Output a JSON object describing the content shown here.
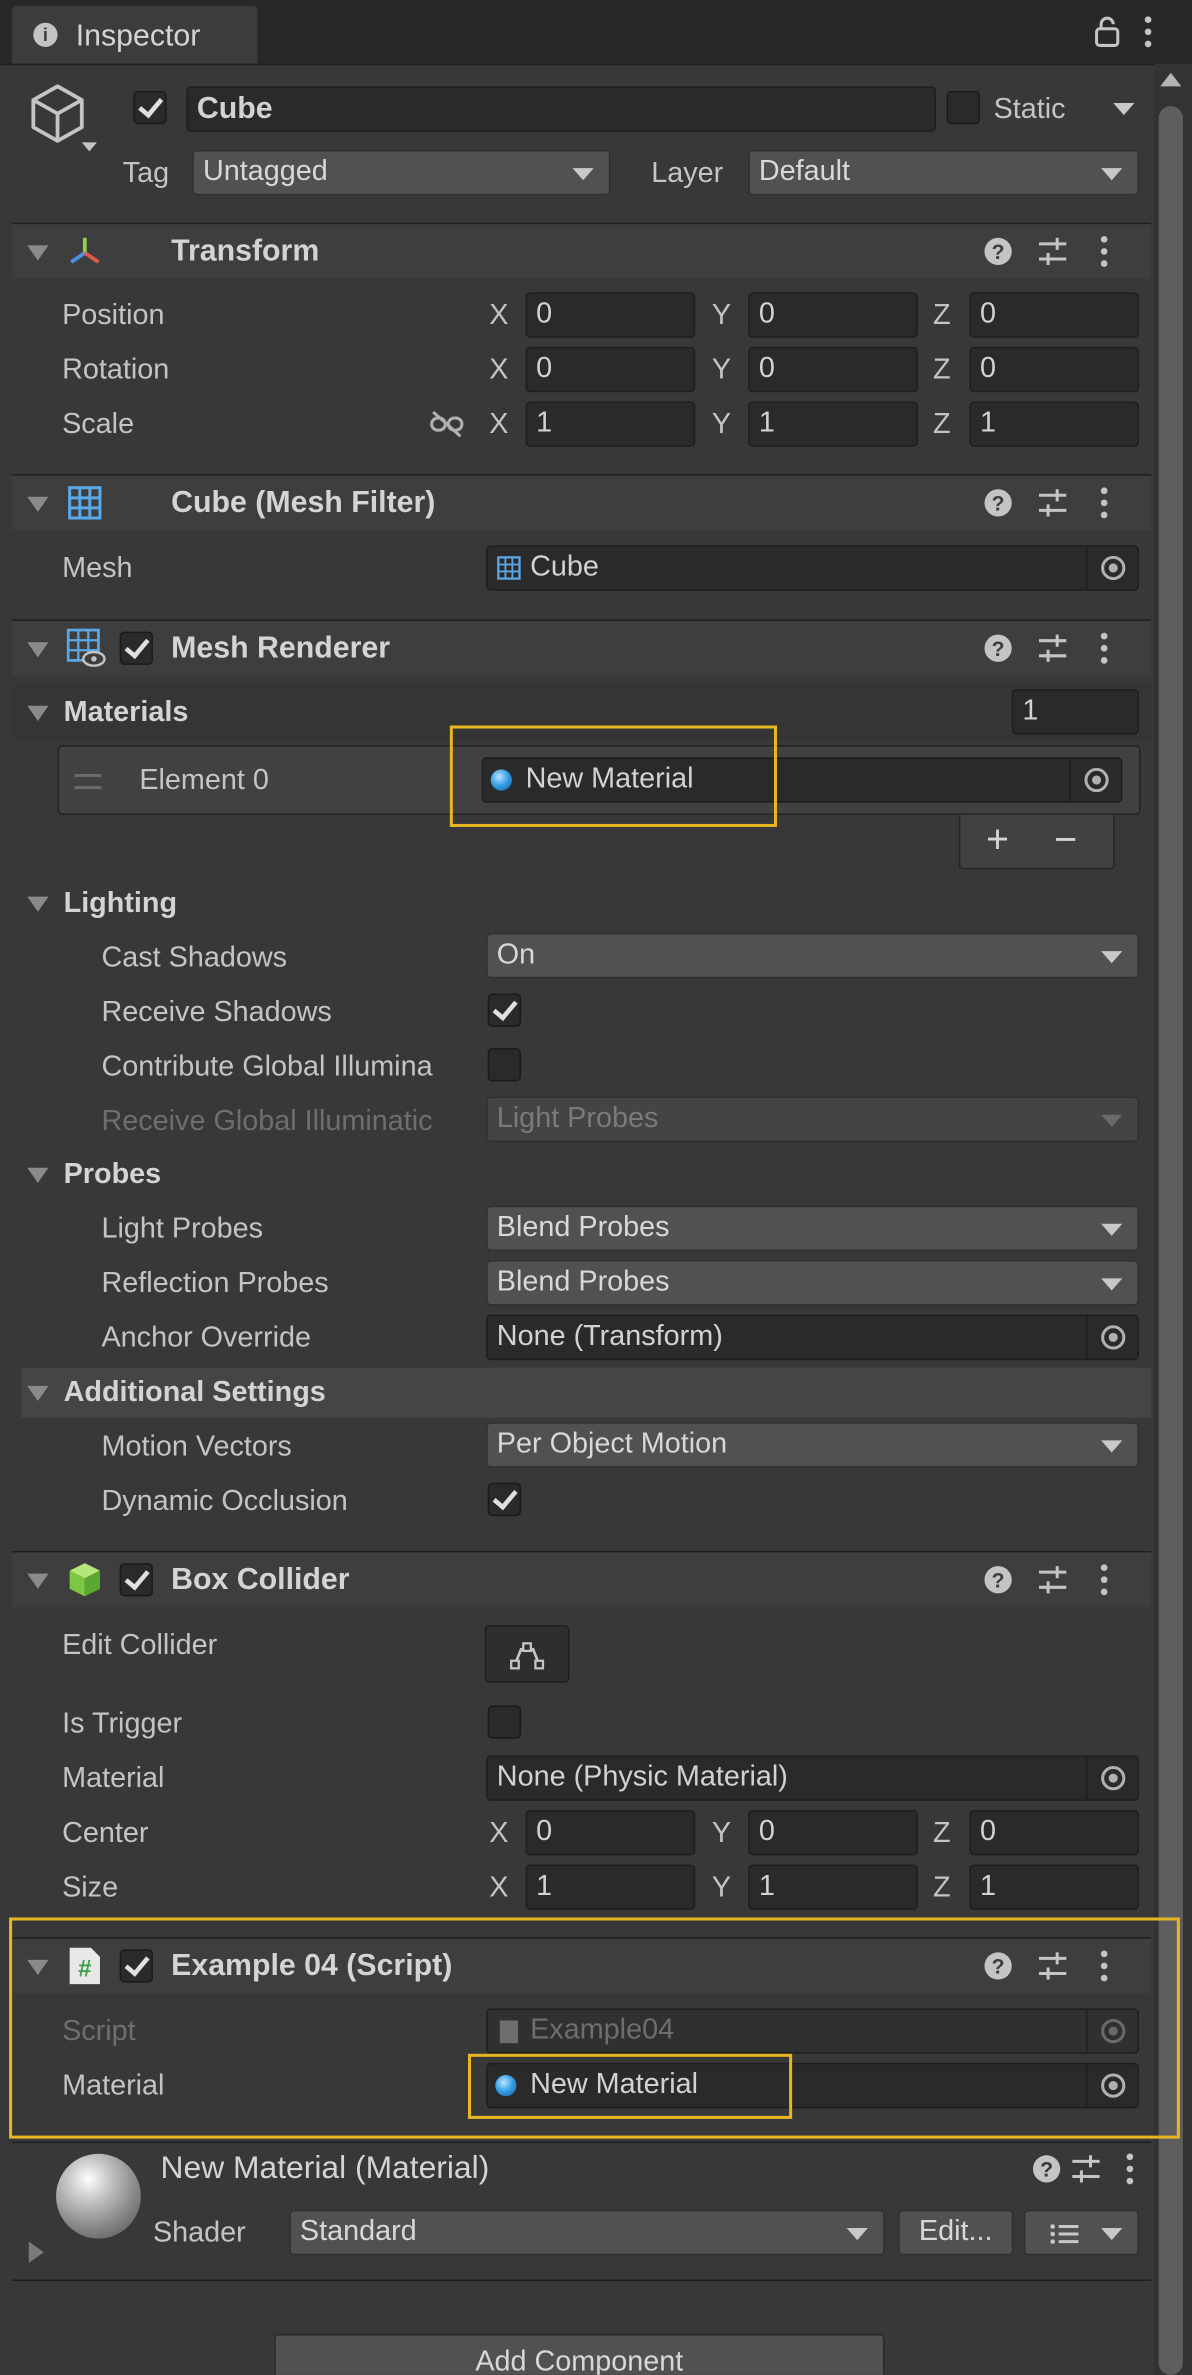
{
  "tab": {
    "title": "Inspector"
  },
  "object": {
    "name": "Cube",
    "static_label": "Static",
    "tag_label": "Tag",
    "tag_value": "Untagged",
    "layer_label": "Layer",
    "layer_value": "Default"
  },
  "transform": {
    "title": "Transform",
    "position": {
      "label": "Position",
      "x": "0",
      "y": "0",
      "z": "0"
    },
    "rotation": {
      "label": "Rotation",
      "x": "0",
      "y": "0",
      "z": "0"
    },
    "scale": {
      "label": "Scale",
      "x": "1",
      "y": "1",
      "z": "1"
    }
  },
  "axes": {
    "x": "X",
    "y": "Y",
    "z": "Z"
  },
  "mesh_filter": {
    "title": "Cube (Mesh Filter)",
    "mesh_label": "Mesh",
    "mesh_value": "Cube"
  },
  "mesh_renderer": {
    "title": "Mesh Renderer",
    "materials_label": "Materials",
    "materials_count": "1",
    "element_label": "Element 0",
    "element_value": "New Material",
    "plus": "+",
    "minus": "−",
    "lighting": {
      "label": "Lighting",
      "cast_shadows_label": "Cast Shadows",
      "cast_shadows_value": "On",
      "receive_shadows_label": "Receive Shadows",
      "contribute_gi_label": "Contribute Global Illumina",
      "receive_gi_label": "Receive Global Illuminatic",
      "receive_gi_value": "Light Probes"
    },
    "probes": {
      "label": "Probes",
      "light_probes_label": "Light Probes",
      "light_probes_value": "Blend Probes",
      "reflection_probes_label": "Reflection Probes",
      "reflection_probes_value": "Blend Probes",
      "anchor_label": "Anchor Override",
      "anchor_value": "None (Transform)"
    },
    "additional": {
      "label": "Additional Settings",
      "motion_vectors_label": "Motion Vectors",
      "motion_vectors_value": "Per Object Motion",
      "dynamic_occlusion_label": "Dynamic Occlusion"
    }
  },
  "box_collider": {
    "title": "Box Collider",
    "edit_label": "Edit Collider",
    "is_trigger_label": "Is Trigger",
    "material_label": "Material",
    "material_value": "None (Physic Material)",
    "center": {
      "label": "Center",
      "x": "0",
      "y": "0",
      "z": "0"
    },
    "size": {
      "label": "Size",
      "x": "1",
      "y": "1",
      "z": "1"
    }
  },
  "script_comp": {
    "title": "Example 04 (Script)",
    "script_label": "Script",
    "script_value": "Example04",
    "material_label": "Material",
    "material_value": "New Material"
  },
  "material_preview": {
    "title": "New Material (Material)",
    "shader_label": "Shader",
    "shader_value": "Standard",
    "edit_button": "Edit..."
  },
  "add_component": "Add Component",
  "colors": {
    "highlight": "#e8b620",
    "background": "#383838",
    "field": "#2a2a2a"
  }
}
